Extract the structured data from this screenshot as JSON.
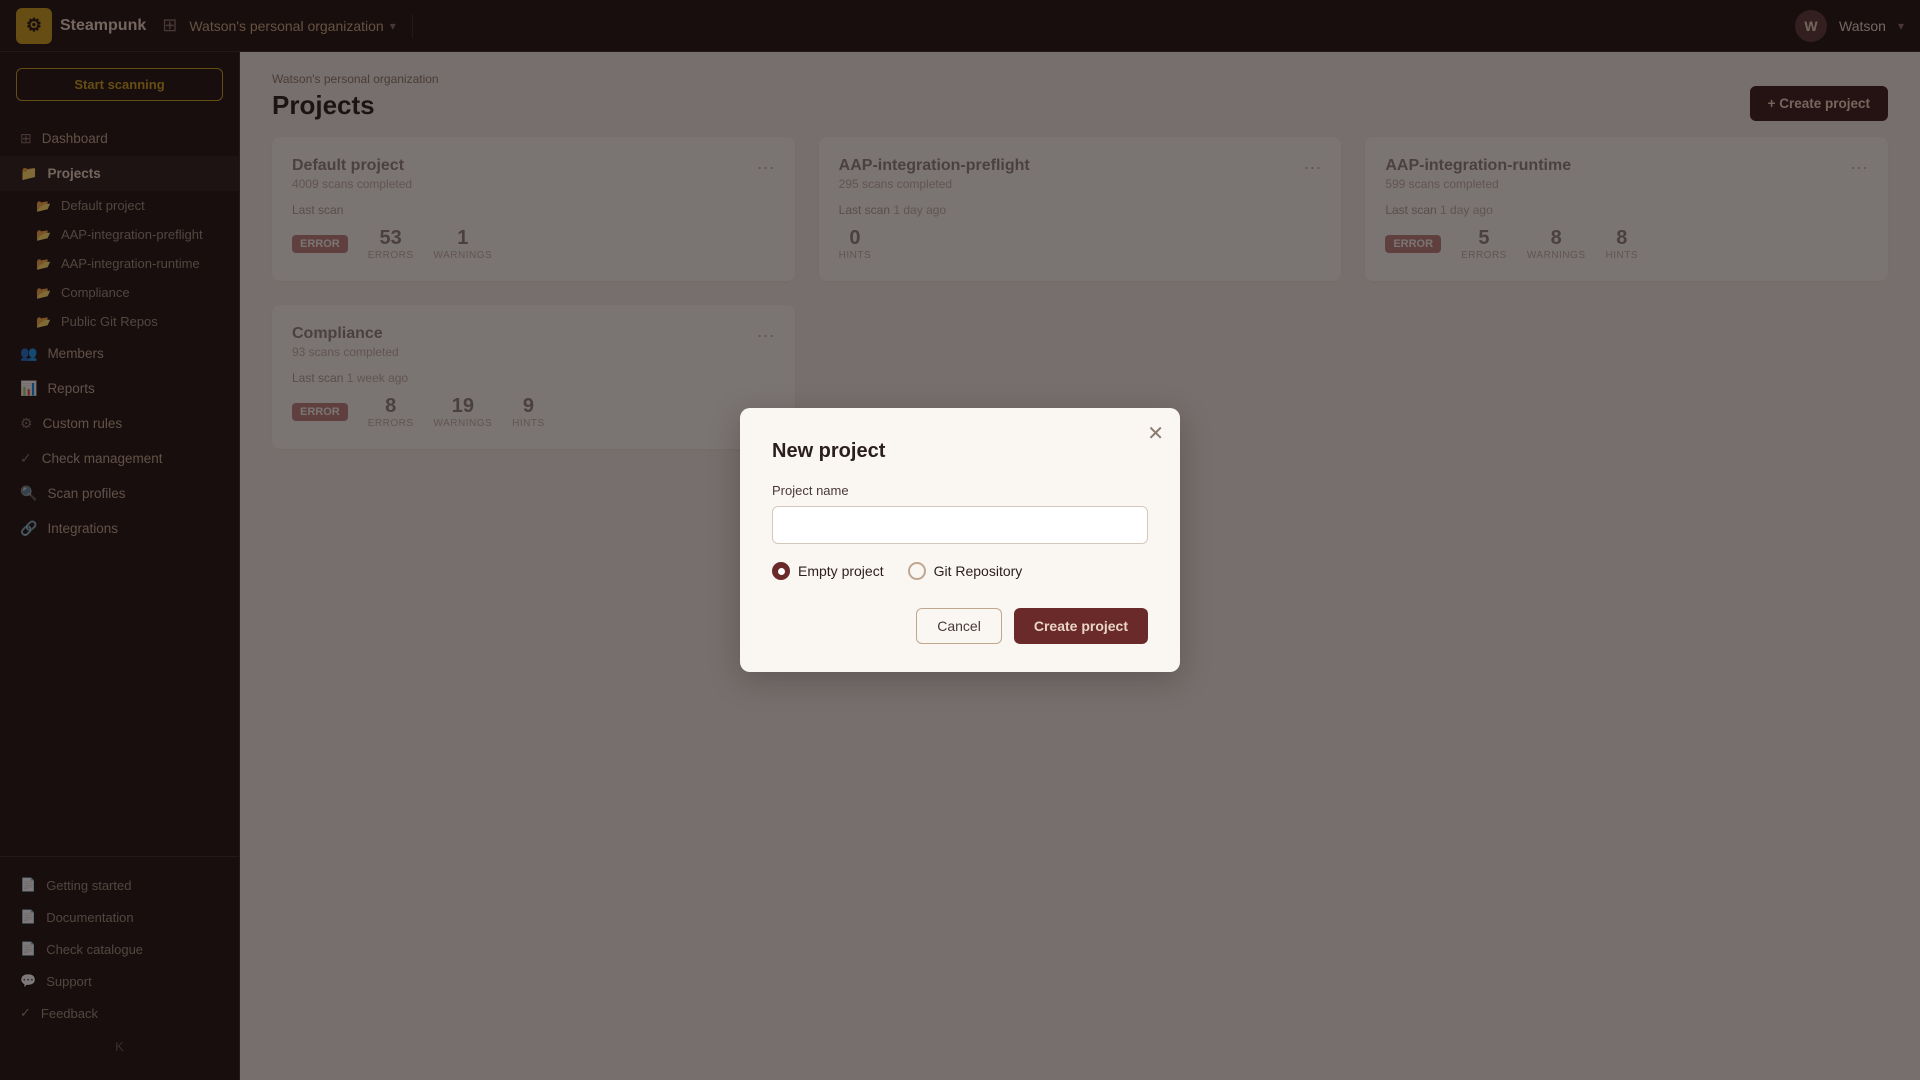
{
  "app": {
    "logo_text": "Steampunk",
    "logo_emoji": "⚙"
  },
  "topbar": {
    "org_name": "Watson's personal organization",
    "user_initial": "W",
    "user_name": "Watson"
  },
  "sidebar": {
    "scan_button": "Start scanning",
    "nav_items": [
      {
        "id": "dashboard",
        "label": "Dashboard",
        "icon": "⊞"
      },
      {
        "id": "projects",
        "label": "Projects",
        "icon": "📁",
        "active": true
      }
    ],
    "project_items": [
      {
        "id": "default-project",
        "label": "Default project",
        "icon": "📂"
      },
      {
        "id": "aap-preflight",
        "label": "AAP-integration-preflight",
        "icon": "📂"
      },
      {
        "id": "aap-runtime",
        "label": "AAP-integration-runtime",
        "icon": "📂"
      },
      {
        "id": "compliance",
        "label": "Compliance",
        "icon": "📂"
      },
      {
        "id": "public-git",
        "label": "Public Git Repos",
        "icon": "📂"
      }
    ],
    "other_nav": [
      {
        "id": "members",
        "label": "Members",
        "icon": ""
      },
      {
        "id": "reports",
        "label": "Reports",
        "icon": ""
      },
      {
        "id": "custom-rules",
        "label": "Custom rules",
        "icon": ""
      },
      {
        "id": "check-management",
        "label": "Check management",
        "icon": ""
      },
      {
        "id": "scan-profiles",
        "label": "Scan profiles",
        "icon": ""
      },
      {
        "id": "integrations",
        "label": "Integrations",
        "icon": ""
      }
    ],
    "bottom_items": [
      {
        "id": "getting-started",
        "label": "Getting started",
        "icon": "📄"
      },
      {
        "id": "documentation",
        "label": "Documentation",
        "icon": "📄"
      },
      {
        "id": "check-catalogue",
        "label": "Check catalogue",
        "icon": "📄"
      },
      {
        "id": "support",
        "label": "Support",
        "icon": "💬"
      },
      {
        "id": "feedback",
        "label": "Feedback",
        "icon": "✓"
      }
    ],
    "collapse_label": "K"
  },
  "page": {
    "breadcrumb": "Watson's personal organization",
    "title": "Projects",
    "create_button": "+ Create project"
  },
  "projects": [
    {
      "id": "default-project",
      "title": "Default project",
      "scans": "4009 scans completed",
      "last_scan_label": "Last scan",
      "status": "ERROR",
      "status_type": "error",
      "errors": 53,
      "warnings": 1,
      "hints": null,
      "time": ""
    },
    {
      "id": "aap-integration-preflight",
      "title": "AAP-integration-preflight",
      "scans": "295 scans completed",
      "last_scan_label": "Last scan",
      "status": null,
      "errors": null,
      "warnings": null,
      "hints": 0,
      "time": "1 day ago"
    },
    {
      "id": "aap-integration-runtime",
      "title": "AAP-integration-runtime",
      "scans": "599 scans completed",
      "last_scan_label": "Last scan",
      "status": "ERROR",
      "status_type": "error",
      "errors": 5,
      "warnings": 8,
      "hints": 8,
      "time": "1 day ago"
    },
    {
      "id": "compliance",
      "title": "Compliance",
      "scans": "93 scans completed",
      "last_scan_label": "Last scan",
      "status": "ERROR",
      "status_type": "error",
      "errors": 8,
      "warnings": 19,
      "hints": 9,
      "time": "1 week ago"
    }
  ],
  "modal": {
    "title": "New project",
    "project_name_label": "Project name",
    "project_name_placeholder": "",
    "option_empty": "Empty project",
    "option_git": "Git Repository",
    "cancel_label": "Cancel",
    "create_label": "Create project",
    "selected_option": "empty"
  }
}
